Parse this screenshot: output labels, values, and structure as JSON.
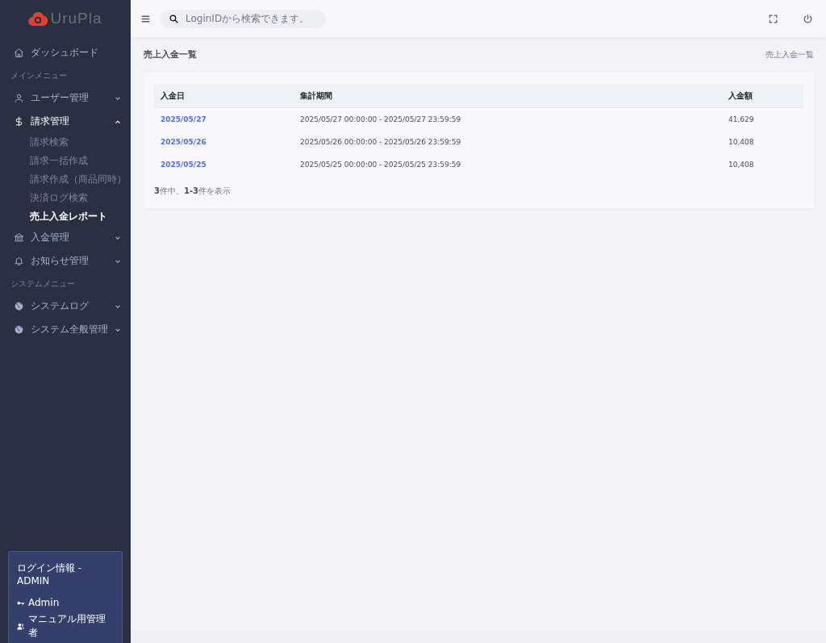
{
  "sidebar": {
    "logo": "UruPla",
    "nav": [
      {
        "kind": "link",
        "label": "ダッシュボード"
      },
      {
        "kind": "section",
        "label": "メインメニュー"
      },
      {
        "kind": "group",
        "label": "ユーザー管理",
        "expanded": false
      },
      {
        "kind": "group",
        "label": "請求管理",
        "expanded": true,
        "children": [
          {
            "label": "請求検索",
            "selected": false
          },
          {
            "label": "請求一括作成",
            "selected": false
          },
          {
            "label": "請求作成（商品同時）",
            "selected": false
          },
          {
            "label": "決済ログ検索",
            "selected": false
          },
          {
            "label": "売上入金レポート",
            "selected": true
          }
        ]
      },
      {
        "kind": "group",
        "label": "入金管理",
        "expanded": false
      },
      {
        "kind": "group",
        "label": "お知らせ管理",
        "expanded": false
      },
      {
        "kind": "section",
        "label": "システムメニュー"
      },
      {
        "kind": "group",
        "label": "システムログ",
        "expanded": false
      },
      {
        "kind": "group",
        "label": "システム全般管理",
        "expanded": false
      }
    ],
    "login": {
      "title": "ログイン情報 - ADMIN",
      "user_id": "Admin",
      "user_name": "マニュアル用管理者"
    }
  },
  "topbar": {
    "search": {
      "placeholder": "LoginIDから検索できます。"
    }
  },
  "page": {
    "title": "売上入金一覧",
    "breadcrumb": "売上入金一覧"
  },
  "table": {
    "columns": [
      "入金日",
      "集計期間",
      "入金額"
    ],
    "rows": [
      [
        "2025/05/27",
        "2025/05/27 00:00:00 - 2025/05/27 23:59:59",
        "41,629"
      ],
      [
        "2025/05/26",
        "2025/05/26 00:00:00 - 2025/05/26 23:59:59",
        "10,408"
      ],
      [
        "2025/05/25",
        "2025/05/25 00:00:00 - 2025/05/25 23:59:59",
        "10,408"
      ]
    ],
    "summary": "**3**件中、**1-3**件を表示"
  }
}
